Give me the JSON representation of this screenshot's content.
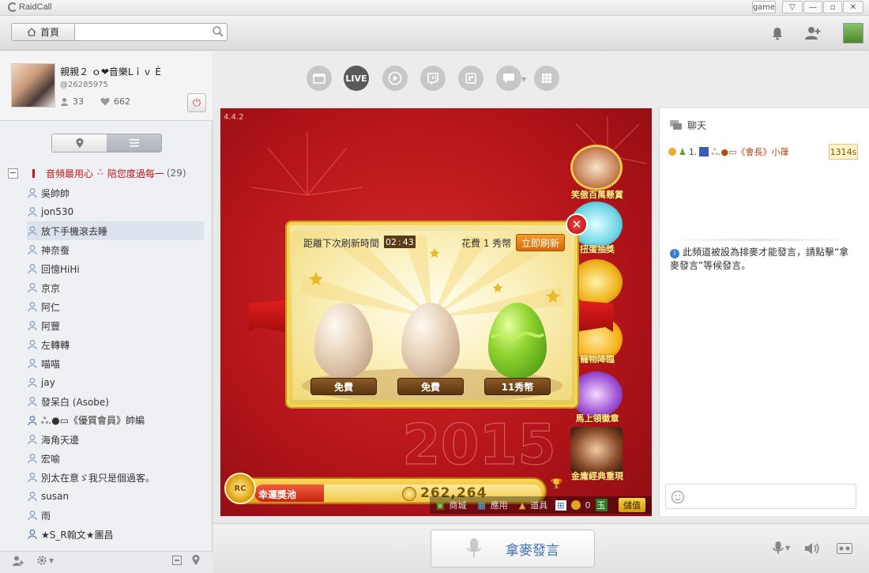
{
  "app": {
    "title": "RaidCall",
    "game_tag": "game"
  },
  "toolbar": {
    "home_label": "首頁",
    "search_placeholder": ""
  },
  "profile": {
    "name": "親親２ ｏ❤音樂Lｉｖ Ė",
    "id": "@26285975",
    "followers": "33",
    "likes": "662"
  },
  "group": {
    "title_part1": "音頻最用心",
    "title_sep": "ஃ",
    "title_part2": "陪您度過每一",
    "count": "(29)"
  },
  "members": [
    "吳帥帥",
    "jon530",
    "放下手機滾去睡",
    "神奈蚕",
    "回憶HiHi",
    "京京",
    "阿仁",
    "阿豐",
    "左轉轉",
    "喵喵",
    "jay",
    "發呆白 (Asobe)",
    "ஃ.●▭《優質會員》帥編",
    "海角天邊",
    "宏喻",
    "別太在意ゞ我只是個過客。",
    "susan",
    "雨",
    "★S_R翰文★團昌"
  ],
  "game": {
    "version": "4.4.2",
    "refresh_label": "距離下次刷新時間",
    "timer_min": "02",
    "timer_sec": "43",
    "cost_label": "花費 1 秀幣",
    "refresh_button": "立即刷新",
    "eggs": [
      "免費",
      "免費",
      "11秀幣"
    ],
    "side_menu": [
      "笑傲百萬懸賞",
      "扭蛋抽獎",
      "",
      "寵物降臨",
      "馬上領徽章",
      "金庸經典重現"
    ],
    "jackpot_label": "幸運獎池",
    "jackpot_value": "262,264",
    "bottom_items": [
      "商城",
      "應用",
      "道具"
    ],
    "coins": "0",
    "jade": "玉",
    "recharge": "儲值"
  },
  "chat": {
    "title": "聊天",
    "queue_index": "1.",
    "queue_name": "ஃ.●▭《會長》小葎",
    "queue_time": "1314s",
    "notice": "此頻道被設為排麥才能發言，請點擊“拿麥發言”等候發言。"
  },
  "bottom": {
    "mic_button": "拿麥發言"
  },
  "colors": {
    "accent_red": "#c4161c",
    "link_blue": "#3f6fb5"
  }
}
